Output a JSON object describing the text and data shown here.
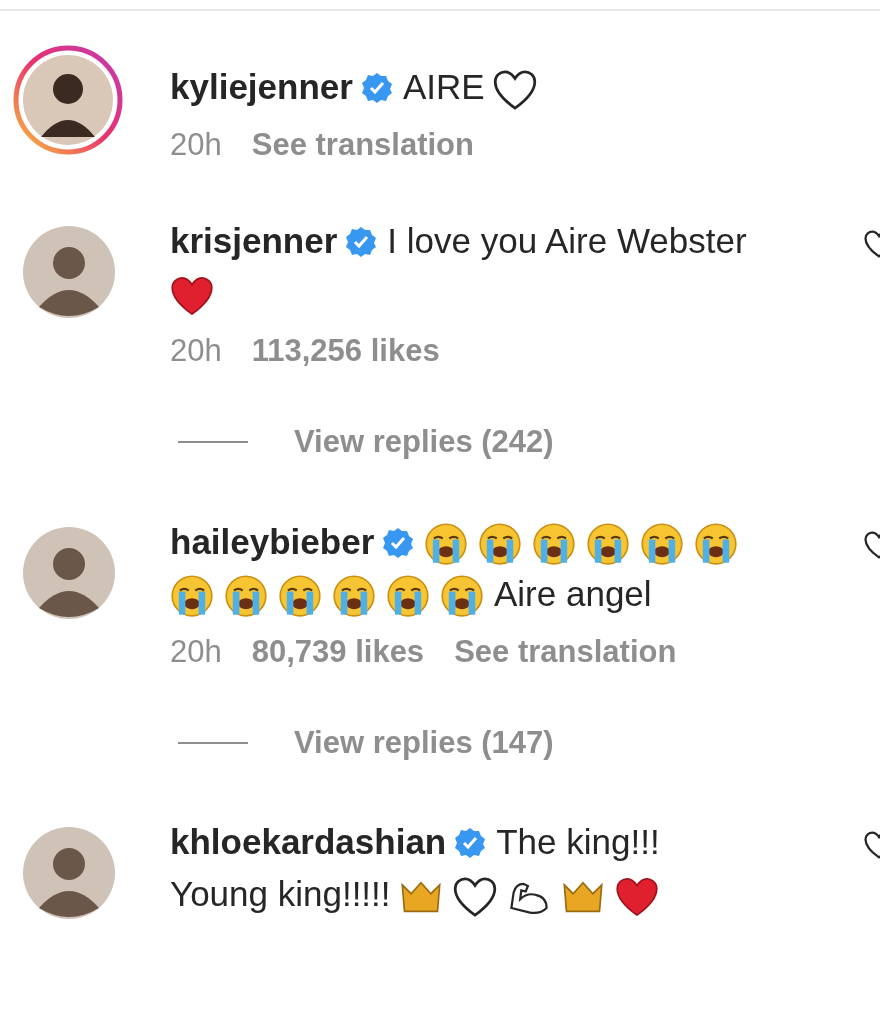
{
  "caption": {
    "username": "kyliejenner",
    "verified": true,
    "story_ring": true,
    "content": [
      {
        "kind": "text",
        "text": "AIRE"
      },
      {
        "kind": "white-heart"
      }
    ],
    "meta": [
      {
        "kind": "time",
        "text": "20h"
      },
      {
        "kind": "link",
        "text": "See translation"
      }
    ]
  },
  "comments": [
    {
      "username": "krisjenner",
      "verified": true,
      "story_ring": false,
      "content": [
        {
          "kind": "text",
          "text": "I love you Aire Webster"
        },
        {
          "kind": "red-heart"
        }
      ],
      "meta": [
        {
          "kind": "time",
          "text": "20h"
        },
        {
          "kind": "link",
          "text": "113,256 likes"
        }
      ],
      "replies": "View replies (242)"
    },
    {
      "username": "haileybieber",
      "verified": true,
      "story_ring": false,
      "content": [
        {
          "kind": "crying-face"
        },
        {
          "kind": "crying-face"
        },
        {
          "kind": "crying-face"
        },
        {
          "kind": "crying-face"
        },
        {
          "kind": "crying-face"
        },
        {
          "kind": "crying-face"
        },
        {
          "kind": "crying-face"
        },
        {
          "kind": "crying-face"
        },
        {
          "kind": "crying-face"
        },
        {
          "kind": "crying-face"
        },
        {
          "kind": "crying-face"
        },
        {
          "kind": "crying-face"
        },
        {
          "kind": "text",
          "text": "Aire angel"
        }
      ],
      "meta": [
        {
          "kind": "time",
          "text": "20h"
        },
        {
          "kind": "link",
          "text": "80,739 likes"
        },
        {
          "kind": "link",
          "text": "See translation"
        }
      ],
      "replies": "View replies (147)"
    },
    {
      "username": "khloekardashian",
      "verified": true,
      "story_ring": false,
      "content": [
        {
          "kind": "text",
          "text": "The king!!!"
        },
        {
          "kind": "text",
          "text": "Young king!!!!!"
        },
        {
          "kind": "crown"
        },
        {
          "kind": "white-heart"
        },
        {
          "kind": "flexed-arm"
        },
        {
          "kind": "crown"
        },
        {
          "kind": "red-heart"
        }
      ]
    }
  ]
}
